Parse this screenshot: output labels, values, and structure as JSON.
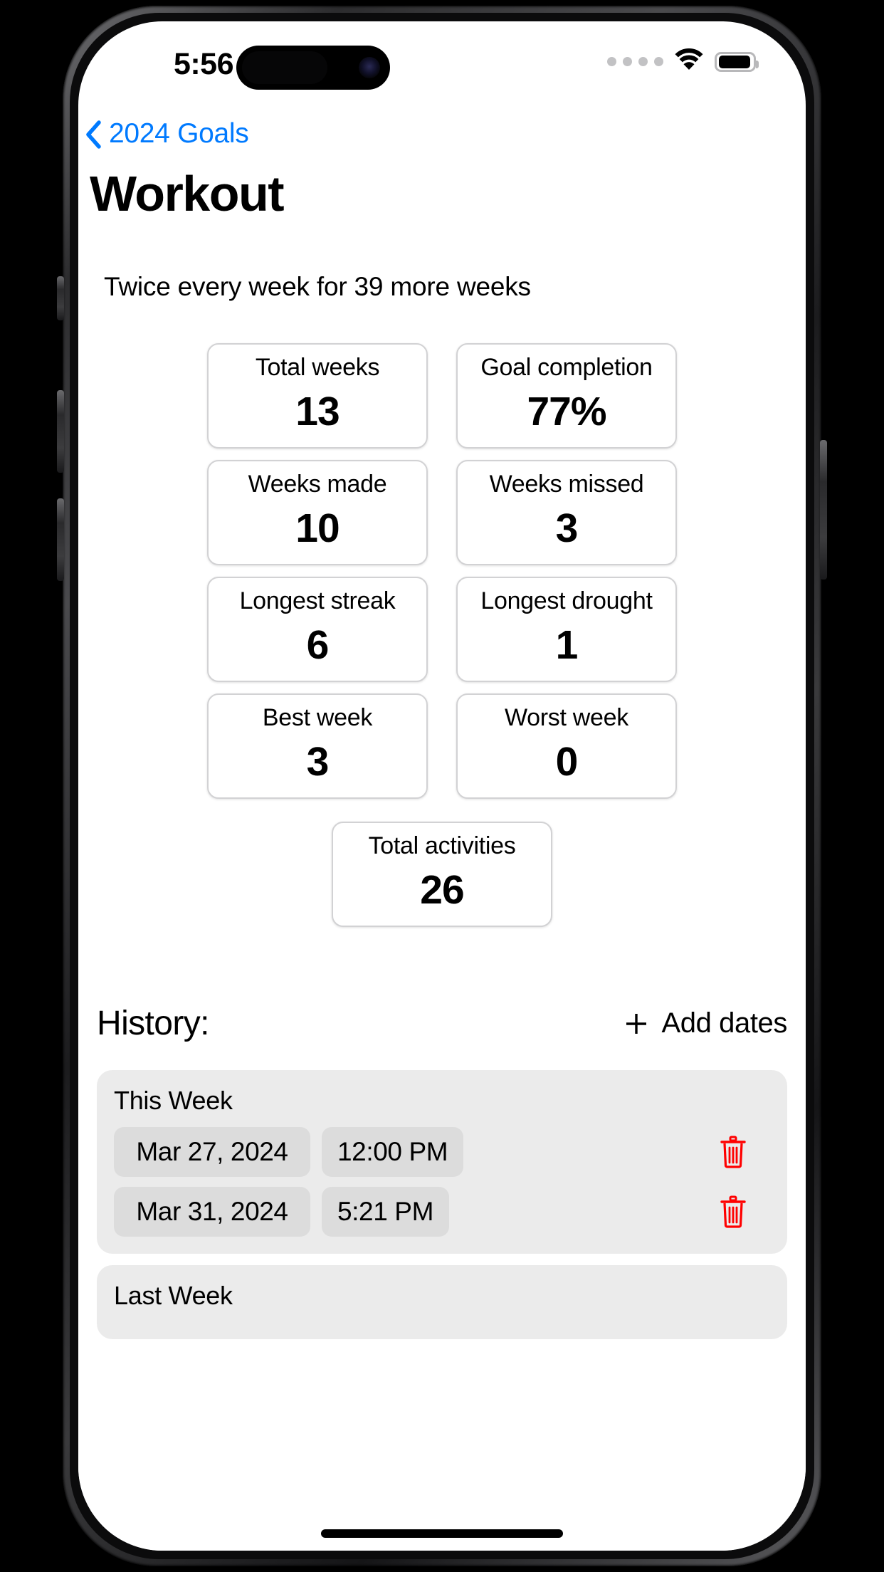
{
  "status_bar": {
    "time": "5:56",
    "signal_icon": "cellular-dots-icon",
    "wifi_icon": "wifi-icon",
    "battery_icon": "battery-full-icon"
  },
  "nav": {
    "back_icon": "chevron-left-icon",
    "back_label": "2024 Goals"
  },
  "header": {
    "title": "Workout",
    "subtitle": "Twice every week for 39 more weeks"
  },
  "stats": [
    {
      "label": "Total weeks",
      "value": "13"
    },
    {
      "label": "Goal completion",
      "value": "77%"
    },
    {
      "label": "Weeks made",
      "value": "10"
    },
    {
      "label": "Weeks missed",
      "value": "3"
    },
    {
      "label": "Longest streak",
      "value": "6"
    },
    {
      "label": "Longest drought",
      "value": "1"
    },
    {
      "label": "Best week",
      "value": "3"
    },
    {
      "label": "Worst week",
      "value": "0"
    }
  ],
  "stat_total": {
    "label": "Total activities",
    "value": "26"
  },
  "history": {
    "title": "History:",
    "add_icon": "plus-icon",
    "add_label": "Add dates",
    "groups": [
      {
        "label": "This Week",
        "entries": [
          {
            "date": "Mar 27, 2024",
            "time": "12:00 PM",
            "delete_icon": "trash-icon"
          },
          {
            "date": "Mar 31, 2024",
            "time": "5:21 PM",
            "delete_icon": "trash-icon"
          }
        ]
      },
      {
        "label": "Last Week",
        "entries": []
      }
    ]
  },
  "colors": {
    "accent_blue": "#007AFF",
    "delete_red": "#FF0000",
    "card_border": "#d2d2d4",
    "group_bg": "#ebebeb",
    "pill_bg": "#dcdcdc"
  }
}
